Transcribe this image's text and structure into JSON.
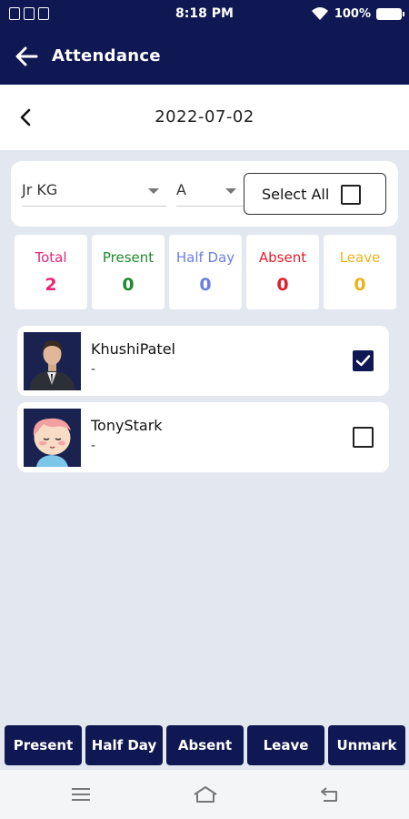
{
  "status_bar": {
    "time": "8:18 PM",
    "battery": "100%"
  },
  "app_bar": {
    "title": "Attendance"
  },
  "date_nav": {
    "date": "2022-07-02"
  },
  "filters": {
    "class_value": "Jr KG",
    "division_value": "A",
    "select_all_label": "Select All"
  },
  "stats": [
    {
      "label": "Total",
      "value": "2",
      "color": "#e6287a"
    },
    {
      "label": "Present",
      "value": "0",
      "color": "#1e8a2c"
    },
    {
      "label": "Half Day",
      "value": "0",
      "color": "#6b7ee6"
    },
    {
      "label": "Absent",
      "value": "0",
      "color": "#e21e2b"
    },
    {
      "label": "Leave",
      "value": "0",
      "color": "#f0b21a"
    }
  ],
  "students": [
    {
      "name": "KhushiPatel",
      "sub": "-",
      "checked": true
    },
    {
      "name": "TonyStark",
      "sub": "-",
      "checked": false
    }
  ],
  "actions": {
    "present": "Present",
    "half_day": "Half Day",
    "absent": "Absent",
    "leave": "Leave",
    "unmark": "Unmark"
  },
  "colors": {
    "primary": "#0f1852",
    "background": "#e3e7ef"
  }
}
